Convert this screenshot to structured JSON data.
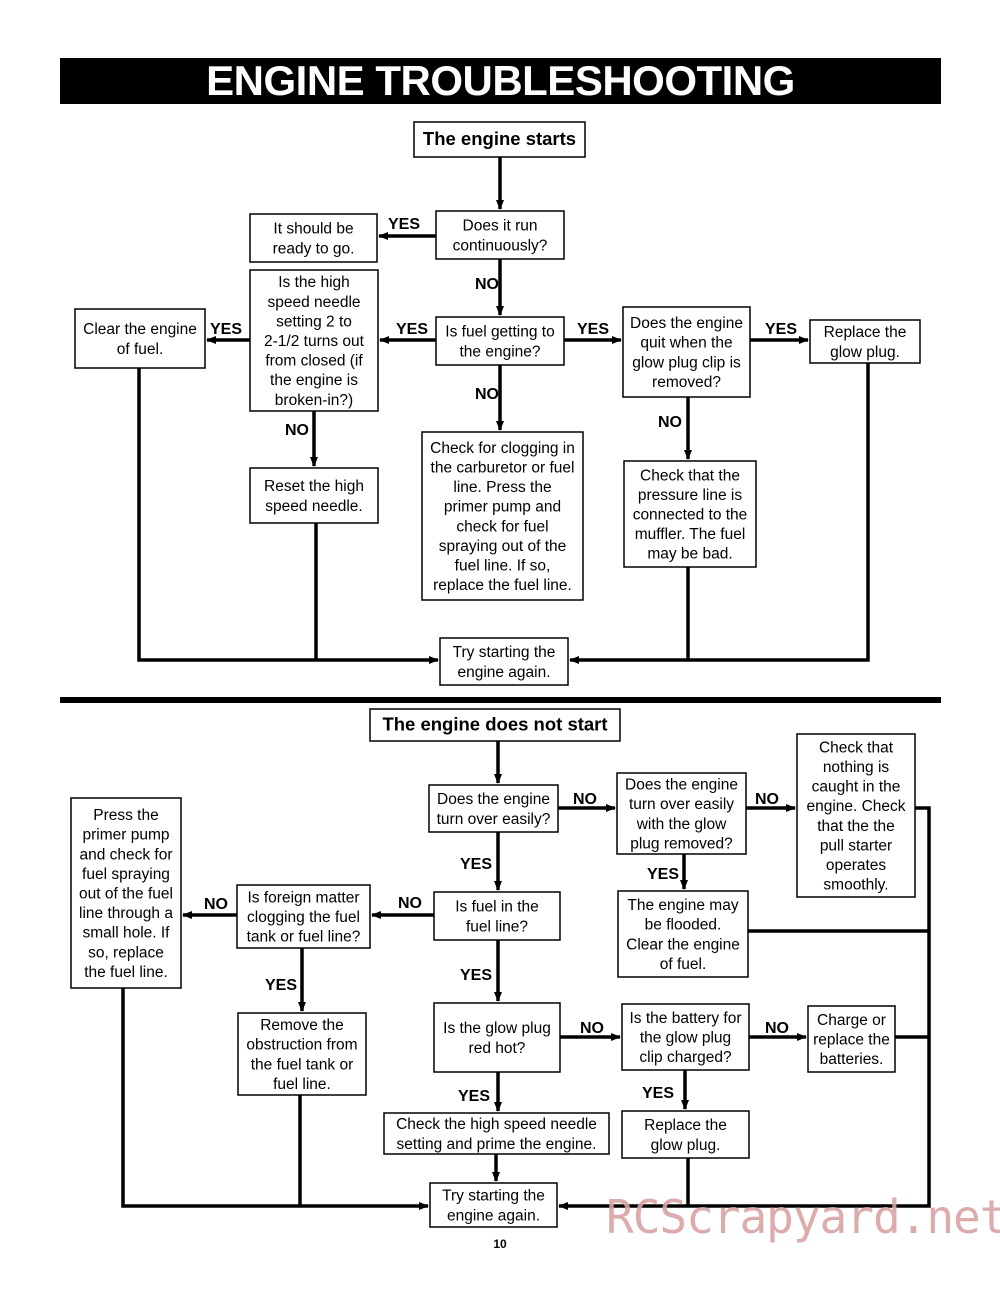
{
  "page": {
    "title": "ENGINE TROUBLESHOOTING",
    "page_number": "10",
    "watermark": "RCScrapyard.net"
  },
  "sections": [
    {
      "name": "engine-starts",
      "nodes": [
        {
          "id": "s_start",
          "type": "title",
          "lines": [
            "The engine starts"
          ]
        },
        {
          "id": "s_run",
          "lines": [
            "Does it run",
            "continuously?"
          ]
        },
        {
          "id": "s_ready",
          "lines": [
            "It should be",
            "ready to go."
          ]
        },
        {
          "id": "s_fuel",
          "lines": [
            "Is fuel getting to",
            "the engine?"
          ]
        },
        {
          "id": "s_needle",
          "lines": [
            "Is the high",
            "speed needle",
            "setting 2 to",
            "2-1/2 turns out",
            "from closed (if",
            "the engine is",
            "broken-in?)"
          ]
        },
        {
          "id": "s_clear",
          "lines": [
            "Clear the engine",
            "of fuel."
          ]
        },
        {
          "id": "s_reset",
          "lines": [
            "Reset the high",
            "speed needle."
          ]
        },
        {
          "id": "s_clog",
          "lines": [
            "Check for clogging in",
            "the carburetor or fuel",
            "line. Press the",
            "primer pump and",
            "check for fuel",
            "spraying out of the",
            "fuel line. If so,",
            "replace the fuel line."
          ]
        },
        {
          "id": "s_quit",
          "lines": [
            "Does the engine",
            "quit when the",
            "glow plug clip is",
            "removed?"
          ]
        },
        {
          "id": "s_replace",
          "lines": [
            "Replace the",
            "glow plug."
          ]
        },
        {
          "id": "s_pressure",
          "lines": [
            "Check that the",
            "pressure line is",
            "connected to the",
            "muffler. The fuel",
            "may be bad."
          ]
        },
        {
          "id": "s_try",
          "lines": [
            "Try starting the",
            "engine again."
          ]
        }
      ],
      "labels": [
        {
          "id": "l1",
          "text": "YES"
        },
        {
          "id": "l2",
          "text": "NO"
        },
        {
          "id": "l3",
          "text": "YES"
        },
        {
          "id": "l4",
          "text": "YES"
        },
        {
          "id": "l5",
          "text": "NO"
        },
        {
          "id": "l6",
          "text": "NO"
        },
        {
          "id": "l7",
          "text": "YES"
        },
        {
          "id": "l8",
          "text": "YES"
        },
        {
          "id": "l9",
          "text": "NO"
        }
      ]
    },
    {
      "name": "engine-does-not-start",
      "nodes": [
        {
          "id": "n_start",
          "type": "title",
          "lines": [
            "The engine does not start"
          ]
        },
        {
          "id": "n_turn",
          "lines": [
            "Does the engine",
            "turn over easily?"
          ]
        },
        {
          "id": "n_turnglow",
          "lines": [
            "Does the engine",
            "turn over easily",
            "with the glow",
            "plug removed?"
          ]
        },
        {
          "id": "n_caught",
          "lines": [
            "Check that",
            "nothing is",
            "caught in the",
            "engine. Check",
            "that the the",
            "pull starter",
            "operates",
            "smoothly."
          ]
        },
        {
          "id": "n_flooded",
          "lines": [
            "The engine may",
            "be flooded.",
            "Clear the engine",
            "of fuel."
          ]
        },
        {
          "id": "n_fuelline",
          "lines": [
            "Is fuel in the",
            "fuel line?"
          ]
        },
        {
          "id": "n_foreign",
          "lines": [
            "Is foreign matter",
            "clogging the fuel",
            "tank or fuel line?"
          ]
        },
        {
          "id": "n_primer",
          "lines": [
            "Press the",
            "primer pump",
            "and check for",
            "fuel spraying",
            "out of the fuel",
            "line through a",
            "small hole. If",
            "so, replace",
            "the fuel line."
          ]
        },
        {
          "id": "n_remove",
          "lines": [
            "Remove the",
            "obstruction from",
            "the fuel tank or",
            "fuel line."
          ]
        },
        {
          "id": "n_redhot",
          "lines": [
            "Is the glow plug",
            "red hot?"
          ]
        },
        {
          "id": "n_battery",
          "lines": [
            "Is the battery for",
            "the glow plug",
            "clip charged?"
          ]
        },
        {
          "id": "n_charge",
          "lines": [
            "Charge or",
            "replace the",
            "batteries."
          ]
        },
        {
          "id": "n_checkneedle",
          "lines": [
            "Check the high speed needle",
            "setting and prime the engine."
          ]
        },
        {
          "id": "n_replaceglow",
          "lines": [
            "Replace the",
            "glow plug."
          ]
        },
        {
          "id": "n_try",
          "lines": [
            "Try starting the",
            "engine again."
          ]
        }
      ],
      "labels": [
        {
          "id": "m1",
          "text": "NO"
        },
        {
          "id": "m2",
          "text": "NO"
        },
        {
          "id": "m3",
          "text": "YES"
        },
        {
          "id": "m4",
          "text": "YES"
        },
        {
          "id": "m5",
          "text": "NO"
        },
        {
          "id": "m6",
          "text": "NO"
        },
        {
          "id": "m7",
          "text": "YES"
        },
        {
          "id": "m8",
          "text": "YES"
        },
        {
          "id": "m9",
          "text": "NO"
        },
        {
          "id": "m10",
          "text": "NO"
        },
        {
          "id": "m11",
          "text": "YES"
        },
        {
          "id": "m12",
          "text": "YES"
        }
      ]
    }
  ]
}
